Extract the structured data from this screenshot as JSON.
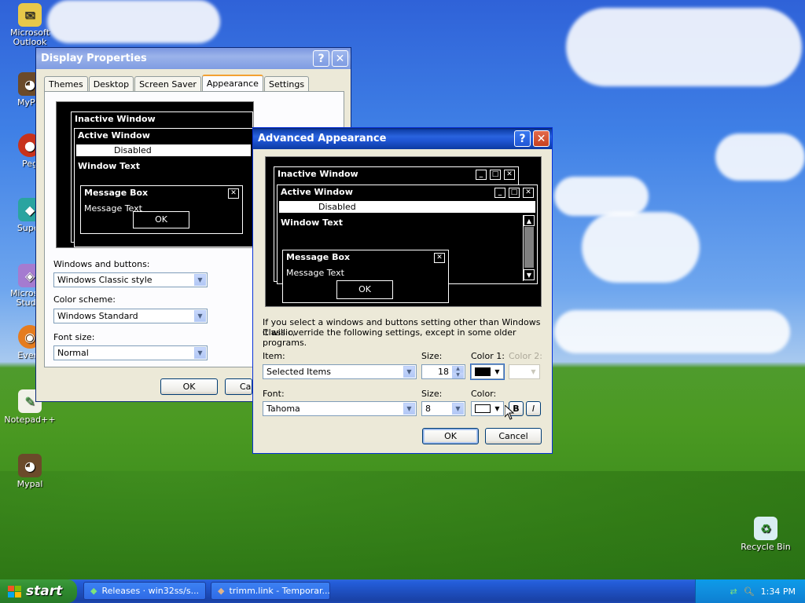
{
  "desktop": {
    "icons": [
      {
        "label": "Microsoft Outlook"
      },
      {
        "label": "MyPal"
      },
      {
        "label": "Peg"
      },
      {
        "label": "Super"
      },
      {
        "label": "Microsoft Studio"
      },
      {
        "label": "Every"
      },
      {
        "label": "Notepad++"
      },
      {
        "label": "Mypal"
      },
      {
        "label": "Recycle Bin"
      }
    ]
  },
  "display_properties": {
    "title": "Display Properties",
    "tabs": [
      "Themes",
      "Desktop",
      "Screen Saver",
      "Appearance",
      "Settings"
    ],
    "selected_tab": "Appearance",
    "preview": {
      "inactive_title": "Inactive Window",
      "active_title": "Active Window",
      "disabled": "Disabled",
      "window_text": "Window Text",
      "message_box_title": "Message Box",
      "message_text": "Message Text",
      "ok": "OK"
    },
    "windows_buttons_label": "Windows and buttons:",
    "windows_buttons_value": "Windows Classic style",
    "color_scheme_label": "Color scheme:",
    "color_scheme_value": "Windows Standard",
    "font_size_label": "Font size:",
    "font_size_value": "Normal",
    "ok": "OK",
    "cancel": "Car"
  },
  "advanced": {
    "title": "Advanced Appearance",
    "preview": {
      "inactive_title": "Inactive Window",
      "active_title": "Active Window",
      "disabled": "Disabled",
      "window_text": "Window Text",
      "message_box_title": "Message Box",
      "message_text": "Message Text",
      "ok": "OK"
    },
    "info_line1": "If you select a windows and buttons setting other than Windows Classic,",
    "info_line2": "it will override the following settings, except in some older programs.",
    "item_label": "Item:",
    "item_value": "Selected Items",
    "size_label": "Size:",
    "size_value": "18",
    "color1_label": "Color 1:",
    "color2_label": "Color 2:",
    "font_label": "Font:",
    "font_value": "Tahoma",
    "font_size_label": "Size:",
    "font_size_value": "8",
    "color_label": "Color:",
    "bold": "B",
    "italic": "I",
    "ok": "OK",
    "cancel": "Cancel",
    "color1_hex": "#000000",
    "color_hex": "#ffffff"
  },
  "taskbar": {
    "start": "start",
    "buttons": [
      "Releases · win32ss/s...",
      "trimm.link - Temporar..."
    ],
    "clock": "1:34 PM"
  }
}
